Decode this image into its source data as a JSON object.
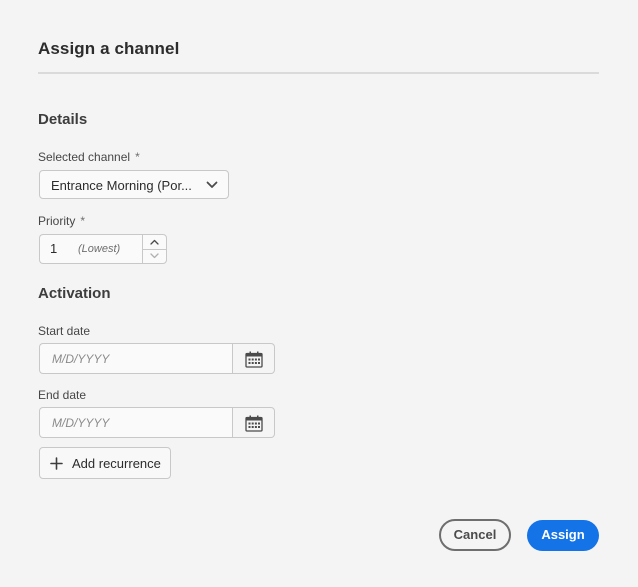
{
  "dialog": {
    "title": "Assign a channel"
  },
  "details": {
    "heading": "Details",
    "channel": {
      "label": "Selected channel",
      "required_mark": "*",
      "value": "Entrance Morning (Por..."
    },
    "priority": {
      "label": "Priority",
      "required_mark": "*",
      "value": "1",
      "hint": "(Lowest)"
    }
  },
  "activation": {
    "heading": "Activation",
    "start_date": {
      "label": "Start date",
      "placeholder": "M/D/YYYY"
    },
    "end_date": {
      "label": "End date",
      "placeholder": "M/D/YYYY"
    },
    "add_recurrence_label": "Add recurrence"
  },
  "footer": {
    "cancel_label": "Cancel",
    "assign_label": "Assign"
  },
  "colors": {
    "accent": "#1473e6",
    "background": "#f4f4f4",
    "border": "#c8c8c8"
  },
  "icons": {
    "picker": "chevron-down-icon",
    "stepper_up": "chevron-up-icon",
    "stepper_down": "chevron-down-icon",
    "date": "calendar-icon",
    "add": "plus-icon"
  }
}
